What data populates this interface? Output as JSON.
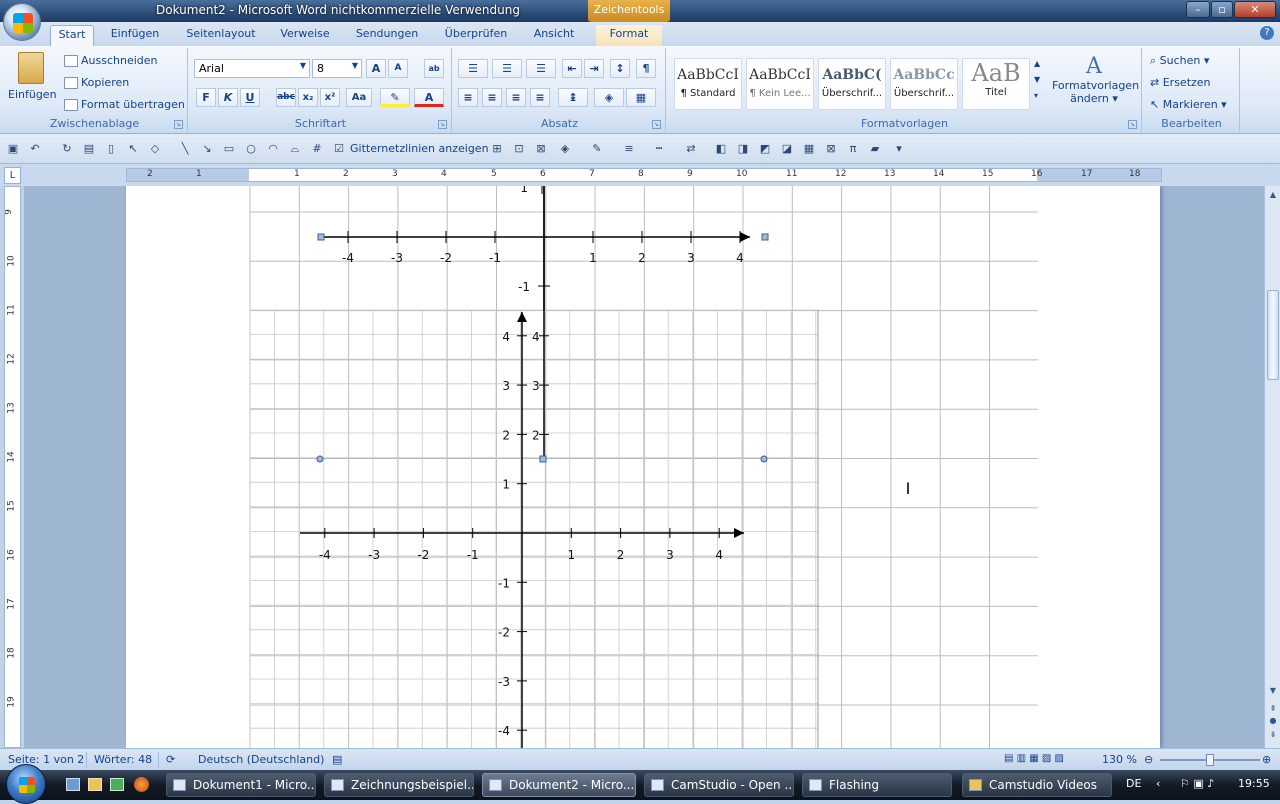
{
  "window": {
    "title": "Dokument2 - Microsoft Word nichtkommerzielle Verwendung",
    "context_tab": "Zeichentools"
  },
  "tabs": [
    "Start",
    "Einfügen",
    "Seitenlayout",
    "Verweise",
    "Sendungen",
    "Überprüfen",
    "Ansicht",
    "Format"
  ],
  "clipboard": {
    "paste": "Einfügen",
    "cut": "Ausschneiden",
    "copy": "Kopieren",
    "format_painter": "Format übertragen",
    "label": "Zwischenablage"
  },
  "font": {
    "name": "Arial",
    "size": "8",
    "label": "Schriftart",
    "bold": "F",
    "italic": "K",
    "underline": "U",
    "strike": "abc",
    "sub": "x₂",
    "sup": "x²",
    "case": "Aa"
  },
  "paragraph": {
    "label": "Absatz",
    "pilcrow": "¶"
  },
  "styles": {
    "items": [
      {
        "preview": "AaBbCcI",
        "name": "¶ Standard"
      },
      {
        "preview": "AaBbCcI",
        "name": "¶ Kein Lee..."
      },
      {
        "preview": "AaBbC(",
        "name": "Überschrif..."
      },
      {
        "preview": "AaBbCc",
        "name": "Überschrif..."
      },
      {
        "preview": "AaB",
        "name": "Titel"
      }
    ],
    "change_line1": "Formatvorlagen",
    "change_line2": "ändern",
    "label": "Formatvorlagen"
  },
  "editing": {
    "find": "Suchen",
    "replace": "Ersetzen",
    "select": "Markieren",
    "label": "Bearbeiten"
  },
  "qat": {
    "gridlines_label": "Gitternetzlinien anzeigen",
    "gridlines_checked": true
  },
  "ruler": {
    "h_labels": [
      "2",
      "1",
      "1",
      "2",
      "3",
      "4",
      "5",
      "6",
      "7",
      "8",
      "9",
      "10",
      "11",
      "12",
      "13",
      "14",
      "15",
      "16",
      "17",
      "18"
    ],
    "v_labels": [
      "9",
      "10",
      "11",
      "12",
      "13",
      "14",
      "15",
      "16",
      "17",
      "18",
      "19"
    ]
  },
  "graphs": {
    "upper": {
      "x_labels": [
        "-4",
        "-3",
        "-2",
        "-1",
        "1",
        "2",
        "3",
        "4"
      ],
      "y_labels": [
        "-1"
      ],
      "top_label": "1"
    },
    "lower": {
      "x_labels": [
        "-4",
        "-3",
        "-2",
        "-1",
        "1",
        "2",
        "3",
        "4"
      ],
      "y_labels": [
        "4",
        "3",
        "2",
        "1",
        "-1",
        "-2",
        "-3",
        "-4"
      ]
    },
    "overlay_labels": [
      "2",
      "3",
      "4"
    ]
  },
  "status": {
    "page": "Seite: 1 von 2",
    "words": "Wörter: 48",
    "language": "Deutsch (Deutschland)",
    "zoom": "130 %"
  },
  "taskbar": {
    "items": [
      {
        "label": "Dokument1 - Micro...",
        "active": false
      },
      {
        "label": "Zeichnungsbeispiel...",
        "active": false
      },
      {
        "label": "Dokument2 - Micro...",
        "active": true
      },
      {
        "label": "CamStudio - Open ...",
        "active": false
      },
      {
        "label": "Flashing",
        "active": false
      },
      {
        "label": "Camstudio Videos",
        "active": false
      }
    ],
    "lang": "DE",
    "clock": "19:55"
  },
  "colors": {
    "accent": "#15428b",
    "ribbon": "#dde9f7",
    "context": "#e0a43a"
  }
}
